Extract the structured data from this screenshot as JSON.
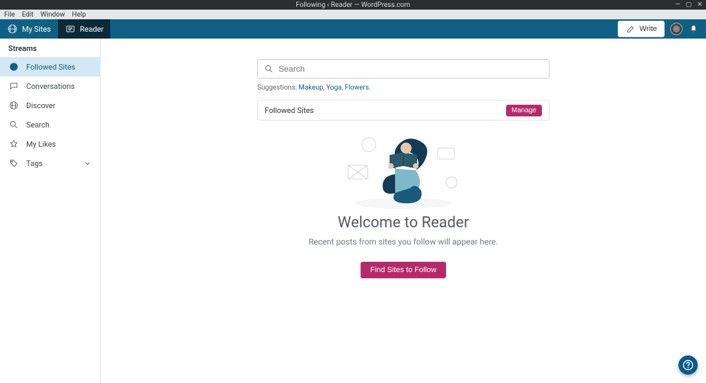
{
  "os": {
    "title": "Following ‹ Reader — WordPress.com"
  },
  "appmenu": [
    "File",
    "Edit",
    "Window",
    "Help"
  ],
  "masterbar": {
    "mysites": "My Sites",
    "reader": "Reader",
    "write": "Write"
  },
  "sidebar": {
    "header": "Streams",
    "items": [
      {
        "icon": "check-circle-icon",
        "label": "Followed Sites"
      },
      {
        "icon": "chat-icon",
        "label": "Conversations"
      },
      {
        "icon": "wp-icon",
        "label": "Discover"
      },
      {
        "icon": "search-icon",
        "label": "Search"
      },
      {
        "icon": "star-icon",
        "label": "My Likes"
      },
      {
        "icon": "tag-icon",
        "label": "Tags"
      }
    ]
  },
  "search": {
    "placeholder": "Search"
  },
  "suggestions": {
    "label": "Suggestions:",
    "items": [
      "Makeup",
      "Yoga",
      "Flowers"
    ]
  },
  "followed_panel": {
    "title": "Followed Sites",
    "manage": "Manage"
  },
  "hero": {
    "title": "Welcome to Reader",
    "subtitle": "Recent posts from sites you follow will appear here.",
    "cta": "Find Sites to Follow"
  },
  "colors": {
    "masterbar": "#0f6084",
    "accent": "#b52a6b"
  }
}
